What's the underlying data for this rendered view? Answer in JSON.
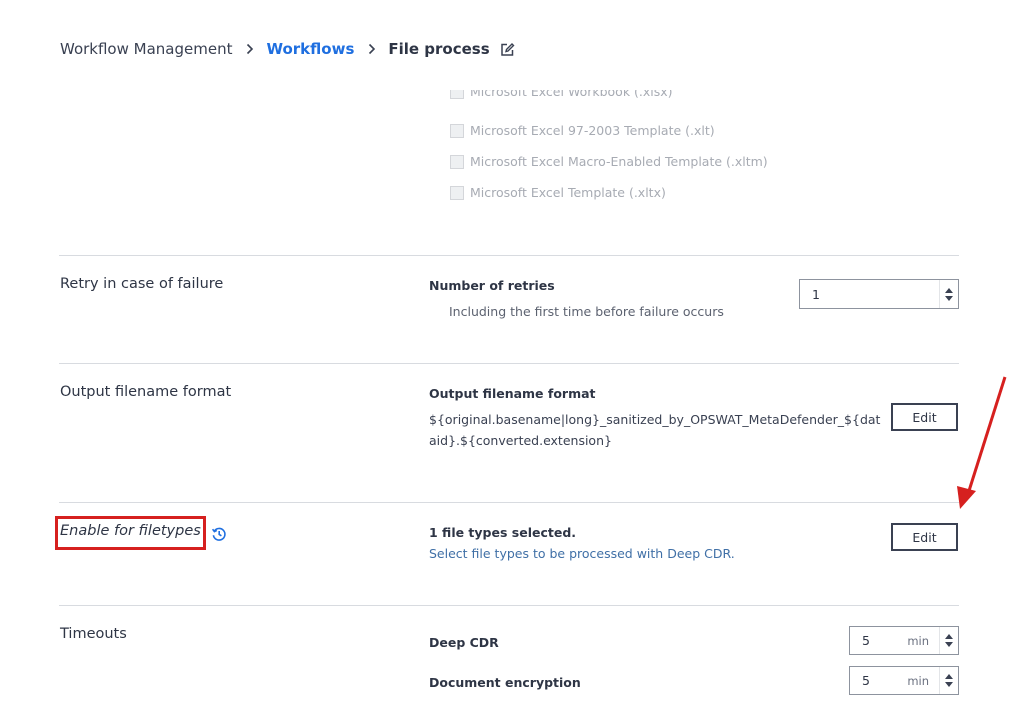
{
  "breadcrumb": {
    "root": "Workflow Management",
    "parent": "Workflows",
    "current": "File process"
  },
  "filetypes_list": [
    "Microsoft Excel Workbook (.xlsx)",
    "Microsoft Excel 97-2003 Template (.xlt)",
    "Microsoft Excel Macro-Enabled Template (.xltm)",
    "Microsoft Excel Template (.xltx)"
  ],
  "retry": {
    "title": "Retry in case of failure",
    "label": "Number of retries",
    "description": "Including the first time before failure occurs",
    "value": "1"
  },
  "output": {
    "title": "Output filename format",
    "label": "Output filename format",
    "format_line1": "${original.basename|long}_sanitized_by_OPSWAT_MetaDefender_${dat",
    "format_line2": "aid}.${converted.extension}",
    "edit_label": "Edit"
  },
  "filetypes": {
    "title": "Enable for filetypes",
    "label": "1 file types selected.",
    "description": "Select file types to be processed with Deep CDR.",
    "edit_label": "Edit"
  },
  "timeouts": {
    "title": "Timeouts",
    "items": [
      {
        "label": "Deep CDR",
        "value": "5",
        "unit": "min"
      },
      {
        "label": "Document encryption",
        "value": "5",
        "unit": "min"
      }
    ]
  },
  "colors": {
    "link": "#1f6fe0",
    "highlight": "#d6201f",
    "text": "#2e3545"
  }
}
